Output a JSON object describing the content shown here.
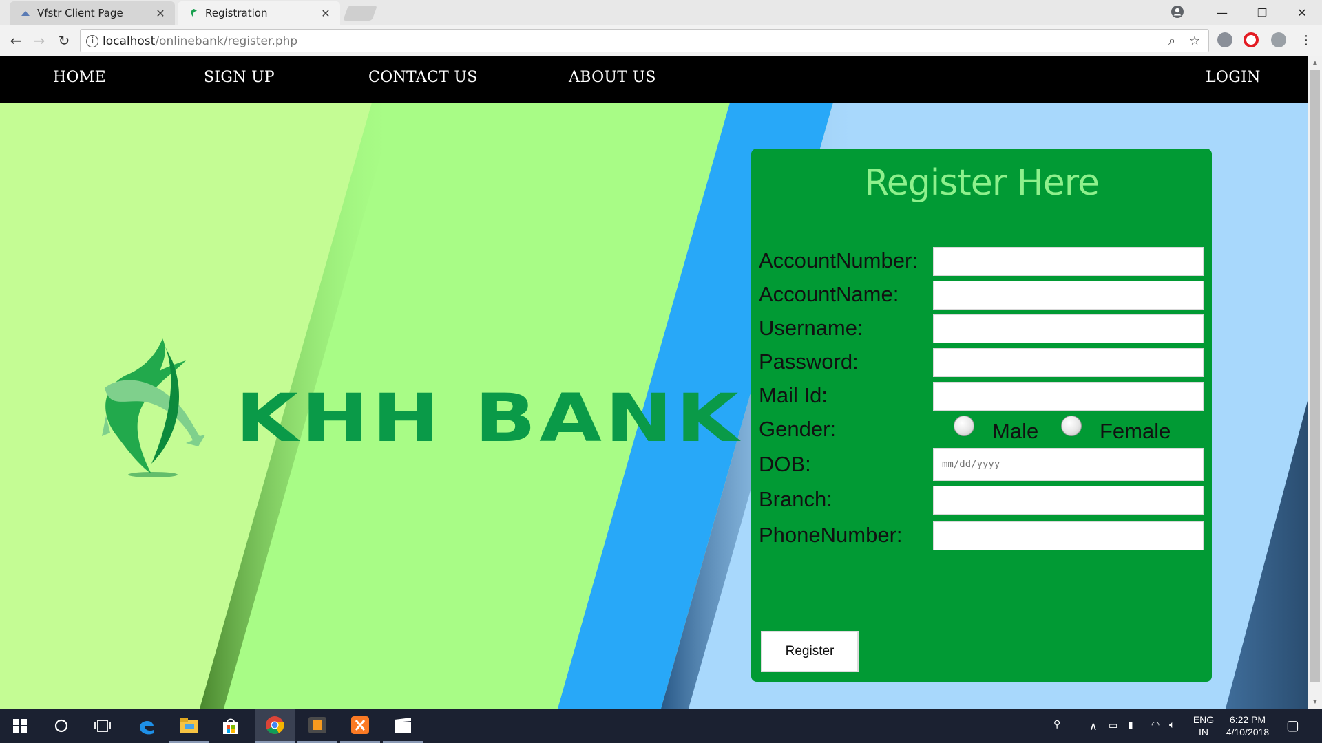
{
  "browser": {
    "tabs": [
      {
        "title": "Vfstr Client Page",
        "active": false
      },
      {
        "title": "Registration",
        "active": true
      }
    ],
    "url_host": "localhost",
    "url_path": "/onlinebank/register.php"
  },
  "nav": {
    "items": [
      "HOME",
      "SIGN UP",
      "CONTACT US",
      "ABOUT US"
    ],
    "login": "LOGIN"
  },
  "logo": {
    "text": "KHH BANK",
    "color": "#0a9a48"
  },
  "form": {
    "title": "Register Here",
    "fields": [
      {
        "label": "AccountNumber:",
        "value": ""
      },
      {
        "label": "AccountName:",
        "value": ""
      },
      {
        "label": "Username:",
        "value": ""
      },
      {
        "label": "Password:",
        "value": ""
      },
      {
        "label": "Mail Id:",
        "value": ""
      }
    ],
    "gender": {
      "label": "Gender:",
      "options": [
        "Male",
        "Female"
      ]
    },
    "dob": {
      "label": "DOB:",
      "placeholder": "mm/dd/yyyy"
    },
    "fields_after": [
      {
        "label": "Branch:",
        "value": ""
      },
      {
        "label": "PhoneNumber:",
        "value": ""
      }
    ],
    "submit": "Register",
    "panel_color": "#019a34",
    "title_color": "#8ef08c"
  },
  "taskbar": {
    "apps": [
      "windows-start",
      "cortana",
      "task-view",
      "edge",
      "file-explorer",
      "store",
      "chrome",
      "sublime-text",
      "xampp",
      "media"
    ],
    "lang_line1": "ENG",
    "lang_line2": "IN",
    "time": "6:22 PM",
    "date": "4/10/2018"
  }
}
